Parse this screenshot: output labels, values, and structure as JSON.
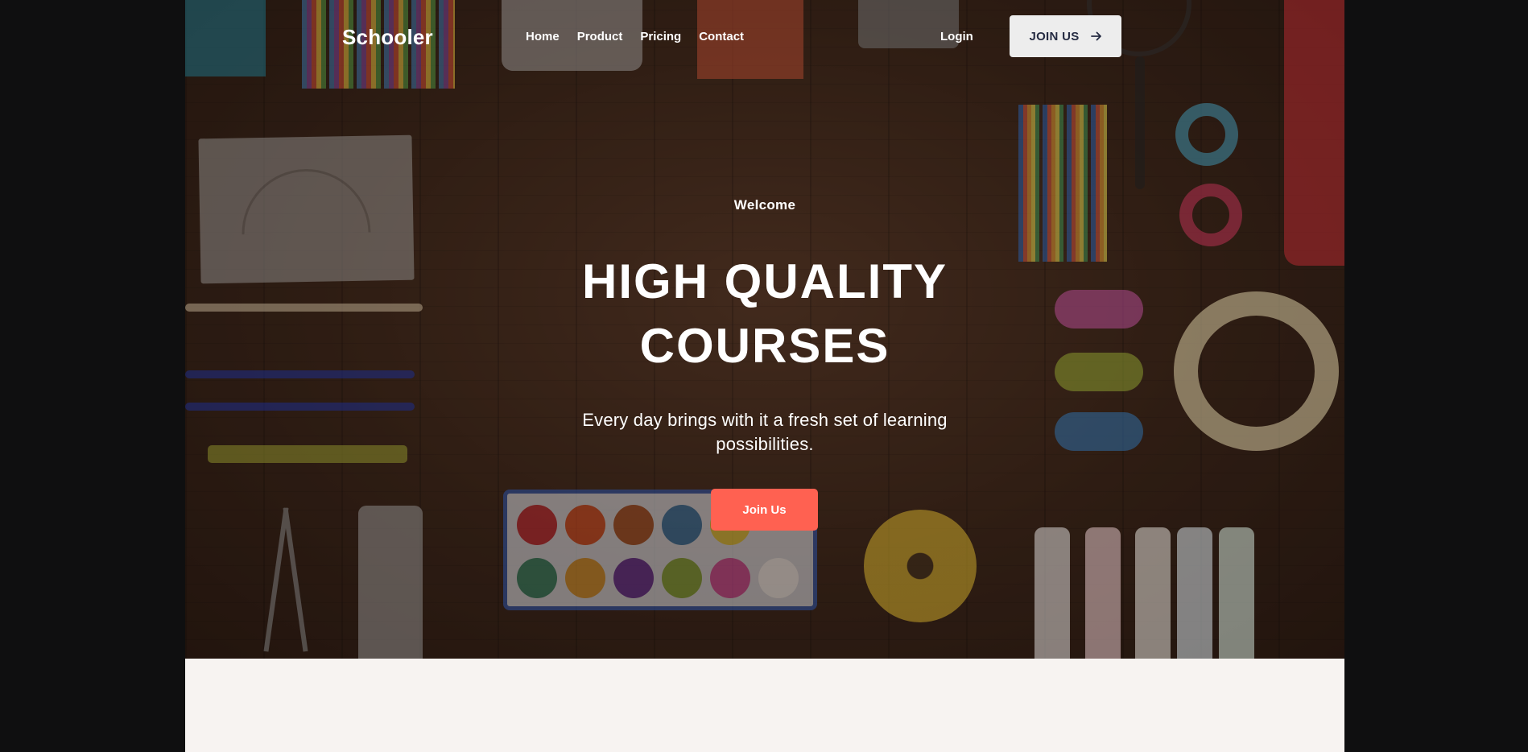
{
  "brand": {
    "name": "Schooler"
  },
  "nav": {
    "links": [
      {
        "label": "Home"
      },
      {
        "label": "Product"
      },
      {
        "label": "Pricing"
      },
      {
        "label": "Contact"
      }
    ],
    "login_label": "Login",
    "join_label": "JOIN US",
    "join_icon": "arrow-right-icon"
  },
  "hero": {
    "eyebrow": "Welcome",
    "headline": "HIGH QUALITY COURSES",
    "subtitle": "Every day brings with it a fresh set of learning possibilities.",
    "cta_label": "Join Us"
  },
  "colors": {
    "accent": "#ff6151",
    "nav_button_bg": "#ededed",
    "nav_button_text": "#252b42",
    "section_bg": "#f7f3f1",
    "backdrop": "#0f0f10"
  }
}
